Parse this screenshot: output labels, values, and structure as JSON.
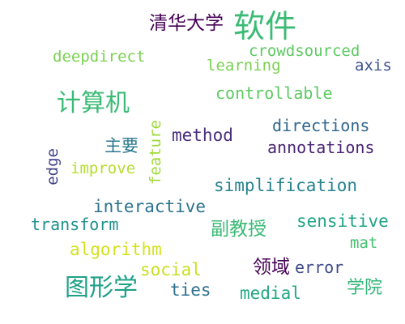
{
  "words": [
    {
      "text": "清华大学",
      "color": "#440154"
    },
    {
      "text": "软件",
      "color": "#3bbb75"
    },
    {
      "text": "deepdirect",
      "color": "#7ad151"
    },
    {
      "text": "crowdsourced",
      "color": "#5ec962"
    },
    {
      "text": "learning",
      "color": "#7ad151"
    },
    {
      "text": "axis",
      "color": "#3b528b"
    },
    {
      "text": "计算机",
      "color": "#3bbb75"
    },
    {
      "text": "controllable",
      "color": "#5ec962"
    },
    {
      "text": "directions",
      "color": "#31688e"
    },
    {
      "text": "主要",
      "color": "#2a788e"
    },
    {
      "text": "method",
      "color": "#472d7b"
    },
    {
      "text": "feature",
      "color": "#a0da39"
    },
    {
      "text": "annotations",
      "color": "#482475"
    },
    {
      "text": "edge",
      "color": "#414487"
    },
    {
      "text": "improve",
      "color": "#b5de2b"
    },
    {
      "text": "simplification",
      "color": "#26828e"
    },
    {
      "text": "interactive",
      "color": "#2c728e"
    },
    {
      "text": "transform",
      "color": "#21918c"
    },
    {
      "text": "副教授",
      "color": "#3bbb75"
    },
    {
      "text": "sensitive",
      "color": "#20a386"
    },
    {
      "text": "algorithm",
      "color": "#d2e21b"
    },
    {
      "text": "mat",
      "color": "#44bf70"
    },
    {
      "text": "social",
      "color": "#c8e020"
    },
    {
      "text": "领域",
      "color": "#440154"
    },
    {
      "text": "error",
      "color": "#3e4a89"
    },
    {
      "text": "图形学",
      "color": "#1fa187"
    },
    {
      "text": "ties",
      "color": "#2d708e"
    },
    {
      "text": "medial",
      "color": "#22a884"
    },
    {
      "text": "学院",
      "color": "#35b779"
    }
  ]
}
